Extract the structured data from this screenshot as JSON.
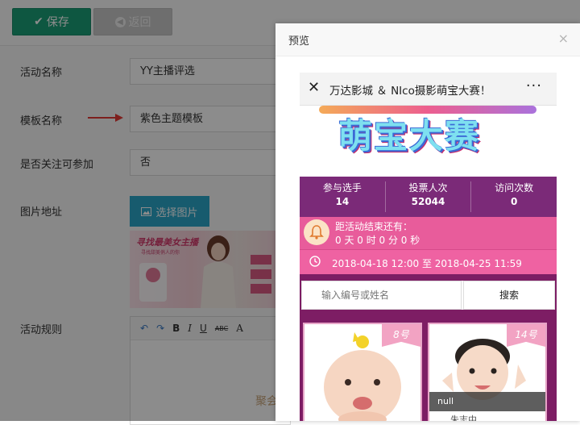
{
  "toolbar": {
    "save_label": "保存",
    "back_label": "返回",
    "save_icon": "check-icon",
    "back_icon": "circle-arrow-icon"
  },
  "form": {
    "activity_name_label": "活动名称",
    "activity_name_value": "YY主播评选",
    "template_name_label": "模板名称",
    "template_name_value": "紫色主题模板",
    "follow_label": "是否关注可参加",
    "follow_value": "否",
    "image_url_label": "图片地址",
    "choose_image_label": "选择图片",
    "banner_title": "寻找最美女主播",
    "banner_subtitle": "寻找甜美俏人的你",
    "rules_label": "活动规则",
    "editor_tools": [
      "B",
      "I",
      "U",
      "ABC",
      "A"
    ],
    "editor_preview_text": "聚会"
  },
  "modal": {
    "title": "预览",
    "close": "×"
  },
  "phone": {
    "nav_close": "✕",
    "nav_title": "万达影城 ＆ NIco摄影萌宝大赛！",
    "nav_more": "···",
    "hero_text": "萌宝大赛",
    "stats": [
      {
        "label": "参与选手",
        "value": "14"
      },
      {
        "label": "投票人次",
        "value": "52044"
      },
      {
        "label": "访问次数",
        "value": "0"
      }
    ],
    "countdown_label": "距活动结束还有：",
    "countdown_value": "0 天 0 时 0 分 0 秒",
    "time_range": "2018-04-18 12:00 至 2018-04-25 11:59",
    "search_placeholder": "输入编号或姓名",
    "search_button": "搜索",
    "cards": [
      {
        "number": "8号",
        "caption": "",
        "name": ""
      },
      {
        "number": "14号",
        "caption": "null",
        "name": "朱志中"
      }
    ]
  },
  "colors": {
    "save_green": "#1b9e77",
    "choose_image_blue": "#2aa6c9",
    "stats_purple": "#7b2a78",
    "countdown_pink": "#e85c9b",
    "card_border": "#e7a4c7"
  }
}
